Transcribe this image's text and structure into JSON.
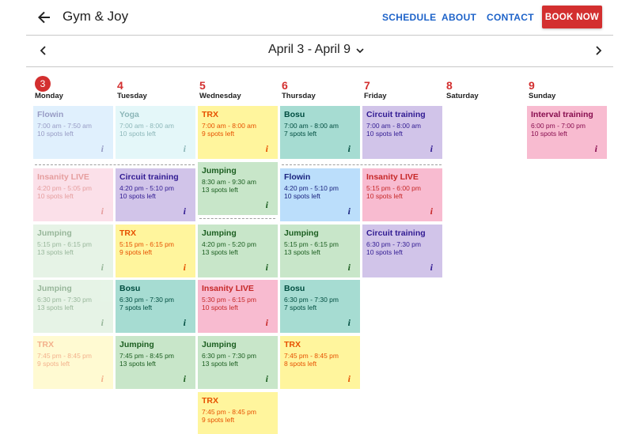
{
  "header": {
    "brand": "Gym & Joy",
    "nav": {
      "schedule": "SCHEDULE",
      "about": "ABOUT",
      "contact": "CONTACT"
    },
    "book_now": "BOOK NOW"
  },
  "date_nav": {
    "range": "April 3 - April 9"
  },
  "days": [
    {
      "num": "3",
      "name": "Monday",
      "today": true
    },
    {
      "num": "4",
      "name": "Tuesday"
    },
    {
      "num": "5",
      "name": "Wednesday"
    },
    {
      "num": "6",
      "name": "Thursday"
    },
    {
      "num": "7",
      "name": "Friday"
    },
    {
      "num": "8",
      "name": "Saturday"
    },
    {
      "num": "9",
      "name": "Sunday"
    }
  ],
  "info_glyph": "i",
  "classes": {
    "mon": [
      {
        "title": "Flowin",
        "time": "7:00 am - 7:50 am",
        "spots": "10 spots left"
      },
      {
        "title": "Insanity LIVE",
        "time": "4:20 pm - 5:05 pm",
        "spots": "10 spots left"
      },
      {
        "title": "Jumping",
        "time": "5:15 pm - 6:15 pm",
        "spots": "13 spots left"
      },
      {
        "title": "Jumping",
        "time": "6:30 pm - 7:30 pm",
        "spots": "13 spots left"
      },
      {
        "title": "TRX",
        "time": "7:45 pm - 8:45 pm",
        "spots": "9 spots left"
      }
    ],
    "tue": [
      {
        "title": "Yoga",
        "time": "7:00 am - 8:00 am",
        "spots": "10 spots left"
      },
      {
        "title": "Circuit training",
        "time": "4:20 pm - 5:10 pm",
        "spots": "10 spots left"
      },
      {
        "title": "TRX",
        "time": "5:15 pm - 6:15 pm",
        "spots": "9 spots left"
      },
      {
        "title": "Bosu",
        "time": "6:30 pm - 7:30 pm",
        "spots": "7 spots left"
      },
      {
        "title": "Jumping",
        "time": "7:45 pm - 8:45 pm",
        "spots": "13 spots left"
      }
    ],
    "wed": [
      {
        "title": "TRX",
        "time": "7:00 am - 8:00 am",
        "spots": "9 spots left"
      },
      {
        "title": "Jumping",
        "time": "8:30 am - 9:30 am",
        "spots": "13 spots left"
      },
      {
        "title": "Jumping",
        "time": "4:20 pm - 5:20 pm",
        "spots": "13 spots left"
      },
      {
        "title": "Insanity LIVE",
        "time": "5:30 pm - 6:15 pm",
        "spots": "10 spots left"
      },
      {
        "title": "Jumping",
        "time": "6:30 pm - 7:30 pm",
        "spots": "13 spots left"
      },
      {
        "title": "TRX",
        "time": "7:45 pm - 8:45 pm",
        "spots": "9 spots left"
      }
    ],
    "thu": [
      {
        "title": "Bosu",
        "time": "7:00 am - 8:00 am",
        "spots": "7 spots left"
      },
      {
        "title": "Flowin",
        "time": "4:20 pm - 5:10 pm",
        "spots": "10 spots left"
      },
      {
        "title": "Jumping",
        "time": "5:15 pm - 6:15 pm",
        "spots": "13 spots left"
      },
      {
        "title": "Bosu",
        "time": "6:30 pm - 7:30 pm",
        "spots": "7 spots left"
      },
      {
        "title": "TRX",
        "time": "7:45 pm - 8:45 pm",
        "spots": "8 spots left"
      }
    ],
    "fri": [
      {
        "title": "Circuit training",
        "time": "7:00 am - 8:00 am",
        "spots": "10 spots left"
      },
      {
        "title": "Insanity LIVE",
        "time": "5:15 pm - 6:00 pm",
        "spots": "10 spots left"
      },
      {
        "title": "Circuit training",
        "time": "6:30 pm - 7:30 pm",
        "spots": "10 spots left"
      }
    ],
    "sun": [
      {
        "title": "Interval training",
        "time": "6:00 pm - 7:00 pm",
        "spots": "10 spots left"
      }
    ]
  },
  "colors": {
    "accent_red": "#d32f2f",
    "nav_blue": "#1e63c9",
    "flowin_bg": "#bbdefb",
    "flowin_fg": "#1a237e",
    "yoga_bg": "#c5eef2",
    "yoga_fg": "#006064",
    "trx_bg": "#fff59d",
    "trx_fg": "#e65100",
    "bosu_bg": "#a6dcd2",
    "bosu_fg": "#004d40",
    "jumping_bg": "#c8e6c9",
    "jumping_fg": "#1b5e20",
    "circuit_bg": "#d1c4e9",
    "circuit_fg": "#311b92",
    "insanity_bg": "#f8bbd0",
    "insanity_fg": "#c62828",
    "interval_bg": "#f8bbd0",
    "interval_fg": "#880e4f"
  }
}
